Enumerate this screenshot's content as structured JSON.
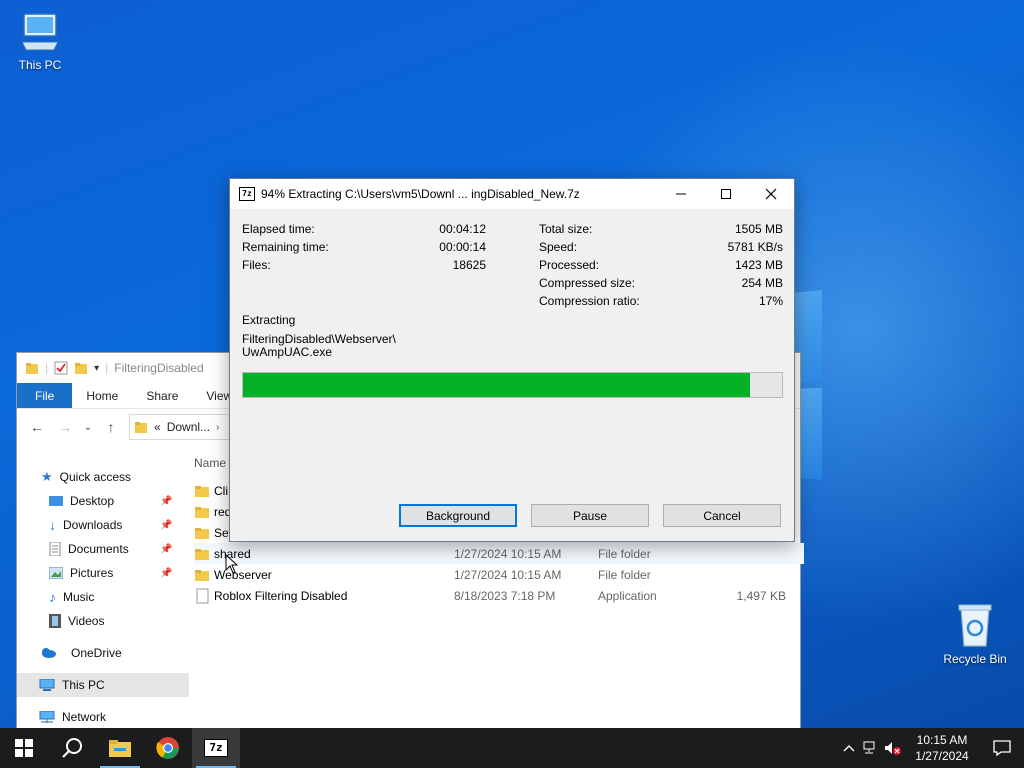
{
  "desktop": {
    "icons": [
      {
        "label": "This PC"
      },
      {
        "label": "Recycle Bin"
      }
    ]
  },
  "explorer": {
    "title": "FilteringDisabled",
    "ribbon_tabs": [
      "File",
      "Home",
      "Share",
      "View"
    ],
    "address": "Downl...",
    "address_prefix": "«",
    "nav": {
      "quick_access": "Quick access",
      "items": [
        "Desktop",
        "Downloads",
        "Documents",
        "Pictures",
        "Music",
        "Videos"
      ],
      "onedrive": "OneDrive",
      "this_pc": "This PC",
      "network": "Network"
    },
    "column_name": "Name",
    "files": [
      {
        "name": "Cli",
        "date": "",
        "type": "",
        "size": ""
      },
      {
        "name": "red",
        "date": "",
        "type": "",
        "size": ""
      },
      {
        "name": "Set",
        "date": "",
        "type": "",
        "size": ""
      },
      {
        "name": "shared",
        "date": "1/27/2024 10:15 AM",
        "type": "File folder",
        "size": ""
      },
      {
        "name": "Webserver",
        "date": "1/27/2024 10:15 AM",
        "type": "File folder",
        "size": ""
      },
      {
        "name": "Roblox Filtering Disabled",
        "date": "8/18/2023 7:18 PM",
        "type": "Application",
        "size": "1,497 KB"
      }
    ]
  },
  "dialog": {
    "app_icon": "7z",
    "title": "94% Extracting C:\\Users\\vm5\\Downl ... ingDisabled_New.7z",
    "left_stats": [
      {
        "label": "Elapsed time:",
        "value": "00:04:12"
      },
      {
        "label": "Remaining time:",
        "value": "00:00:14"
      },
      {
        "label": "Files:",
        "value": "18625"
      }
    ],
    "right_stats": [
      {
        "label": "Total size:",
        "value": "1505 MB"
      },
      {
        "label": "Speed:",
        "value": "5781 KB/s"
      },
      {
        "label": "Processed:",
        "value": "1423 MB"
      },
      {
        "label": "Compressed size:",
        "value": "254 MB"
      },
      {
        "label": "Compression ratio:",
        "value": "17%"
      }
    ],
    "operation": "Extracting",
    "current_path_line1": "FilteringDisabled\\Webserver\\",
    "current_path_line2": "UwAmpUAC.exe",
    "progress_percent": 94,
    "buttons": {
      "background": "Background",
      "pause": "Pause",
      "cancel": "Cancel"
    }
  },
  "taskbar": {
    "time": "10:15 AM",
    "date": "1/27/2024",
    "active_app_label": "7z"
  },
  "colors": {
    "progress": "#06b025",
    "taskbar": "#1c1c1c",
    "file_tab": "#1a6fc9",
    "wallpaper": "#0a63c9"
  }
}
